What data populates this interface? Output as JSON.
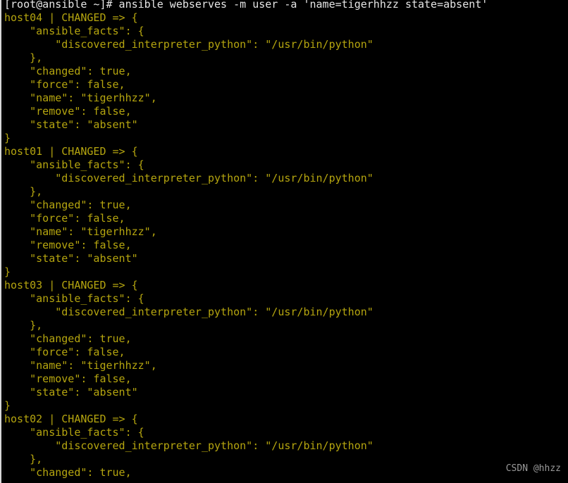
{
  "terminal": {
    "title": "ansible ad-hoc command output",
    "colors": {
      "background": "#000000",
      "output_text": "#b5a50f",
      "prompt_text": "#e6e6e6",
      "watermark_text": "#9a9a9a",
      "left_edge_strip": "#d8d8d8"
    },
    "clipped_top_line": "}",
    "lines": [
      {
        "text": "[root@ansible ~]# ansible webserves -m user -a 'name=tigerhhzz state=absent'",
        "kind": "prompt"
      },
      {
        "text": "host04 | CHANGED => {",
        "kind": "output"
      },
      {
        "text": "    \"ansible_facts\": {",
        "kind": "output"
      },
      {
        "text": "        \"discovered_interpreter_python\": \"/usr/bin/python\"",
        "kind": "output"
      },
      {
        "text": "    },",
        "kind": "output"
      },
      {
        "text": "    \"changed\": true,",
        "kind": "output"
      },
      {
        "text": "    \"force\": false,",
        "kind": "output"
      },
      {
        "text": "    \"name\": \"tigerhhzz\",",
        "kind": "output"
      },
      {
        "text": "    \"remove\": false,",
        "kind": "output"
      },
      {
        "text": "    \"state\": \"absent\"",
        "kind": "output"
      },
      {
        "text": "}",
        "kind": "output"
      },
      {
        "text": "host01 | CHANGED => {",
        "kind": "output"
      },
      {
        "text": "    \"ansible_facts\": {",
        "kind": "output"
      },
      {
        "text": "        \"discovered_interpreter_python\": \"/usr/bin/python\"",
        "kind": "output"
      },
      {
        "text": "    },",
        "kind": "output"
      },
      {
        "text": "    \"changed\": true,",
        "kind": "output"
      },
      {
        "text": "    \"force\": false,",
        "kind": "output"
      },
      {
        "text": "    \"name\": \"tigerhhzz\",",
        "kind": "output"
      },
      {
        "text": "    \"remove\": false,",
        "kind": "output"
      },
      {
        "text": "    \"state\": \"absent\"",
        "kind": "output"
      },
      {
        "text": "}",
        "kind": "output"
      },
      {
        "text": "host03 | CHANGED => {",
        "kind": "output"
      },
      {
        "text": "    \"ansible_facts\": {",
        "kind": "output"
      },
      {
        "text": "        \"discovered_interpreter_python\": \"/usr/bin/python\"",
        "kind": "output"
      },
      {
        "text": "    },",
        "kind": "output"
      },
      {
        "text": "    \"changed\": true,",
        "kind": "output"
      },
      {
        "text": "    \"force\": false,",
        "kind": "output"
      },
      {
        "text": "    \"name\": \"tigerhhzz\",",
        "kind": "output"
      },
      {
        "text": "    \"remove\": false,",
        "kind": "output"
      },
      {
        "text": "    \"state\": \"absent\"",
        "kind": "output"
      },
      {
        "text": "}",
        "kind": "output"
      },
      {
        "text": "host02 | CHANGED => {",
        "kind": "output"
      },
      {
        "text": "    \"ansible_facts\": {",
        "kind": "output"
      },
      {
        "text": "        \"discovered_interpreter_python\": \"/usr/bin/python\"",
        "kind": "output"
      },
      {
        "text": "    },",
        "kind": "output"
      },
      {
        "text": "    \"changed\": true,",
        "kind": "output"
      }
    ]
  },
  "watermark": {
    "label": "CSDN @hhzz"
  }
}
